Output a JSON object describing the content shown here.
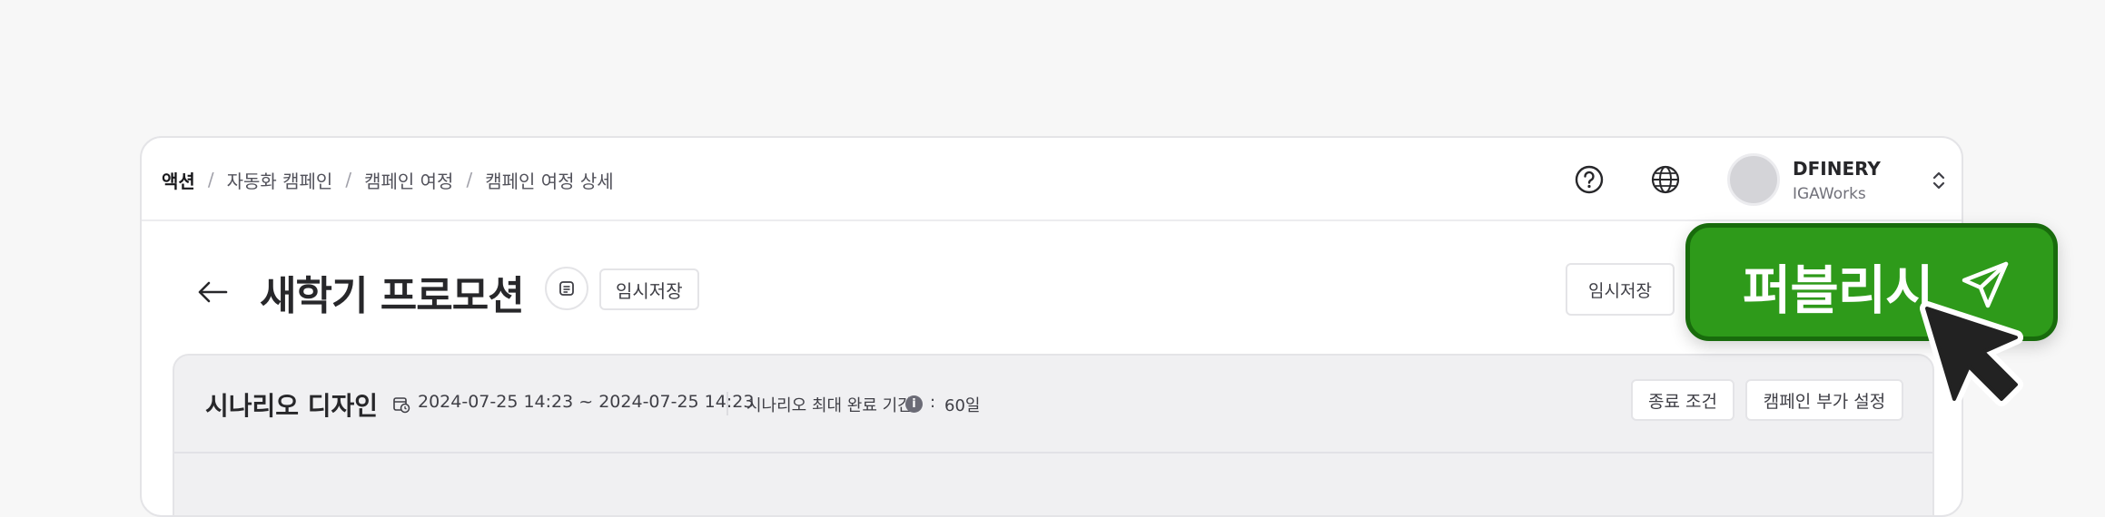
{
  "breadcrumb": {
    "current": "액션",
    "items": [
      "자동화 캠페인",
      "캠페인 여정",
      "캠페인 여정 상세"
    ],
    "separator": "/"
  },
  "topbar": {
    "help_icon": "question-circle-icon",
    "language_icon": "globe-icon",
    "org_name": "DFINERY",
    "org_sub": "IGAWorks",
    "switcher_icon": "chevron-up-down-icon"
  },
  "page": {
    "title": "새학기 프로모션",
    "status_chip": "임시저장",
    "save_label": "임시저장",
    "publish_label": "퍼블리시"
  },
  "scenario": {
    "title": "시나리오 디자인",
    "date_range": "2024-07-25 14:23 ~ 2024-07-25 14:23",
    "duration_label": "시나리오 최대 완료 기간",
    "duration_sep": ":",
    "duration_value": "60일",
    "end_condition_label": "종료 조건",
    "extra_settings_label": "캠페인 부가 설정"
  },
  "colors": {
    "publish": "#2e9a1a",
    "publish_border": "#186b0c",
    "background": "#f7f7f7"
  }
}
